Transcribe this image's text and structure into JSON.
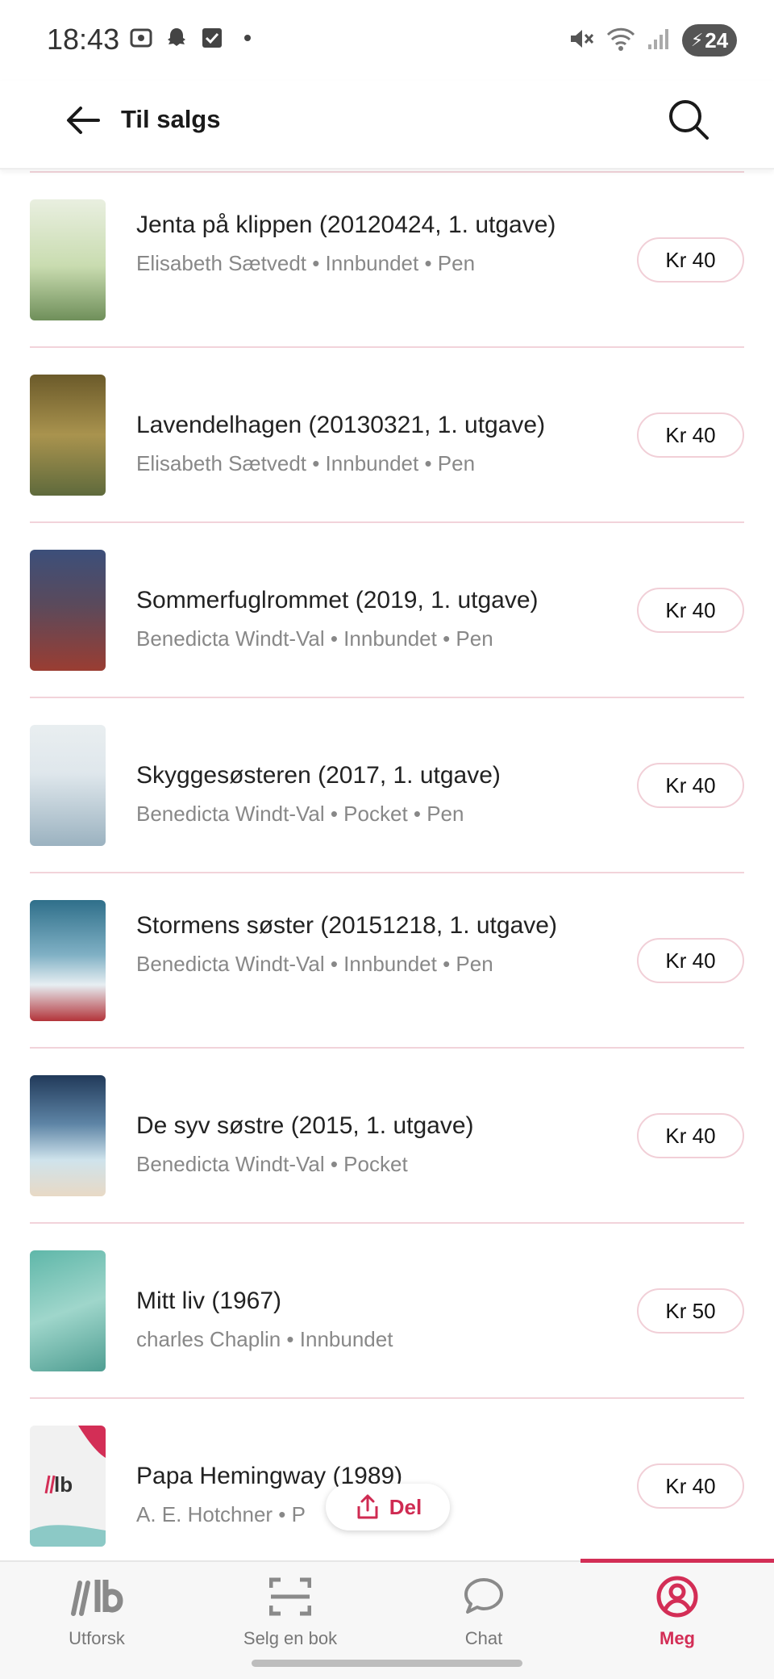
{
  "status_bar": {
    "time": "18:43",
    "battery": "24"
  },
  "app_bar": {
    "title": "Til salgs"
  },
  "books": [
    {
      "title": "Jenta på klippen (20120424, 1. utgave)",
      "meta": "Elisabeth Sætvedt • Innbundet • Pen",
      "price": "Kr 40",
      "cover_colors": [
        "#c9dcb0",
        "#6f8f5a"
      ]
    },
    {
      "title": "Lavendelhagen (20130321, 1. utgave)",
      "meta": "Elisabeth Sætvedt • Innbundet • Pen",
      "price": "Kr 40",
      "cover_colors": [
        "#6b5a2a",
        "#a9934e"
      ]
    },
    {
      "title": "Sommerfuglrommet (2019, 1. utgave)",
      "meta": "Benedicta Windt-Val • Innbundet • Pen",
      "price": "Kr 40",
      "cover_colors": [
        "#3c4f7a",
        "#9a3d32"
      ]
    },
    {
      "title": "Skyggesøsteren (2017, 1. utgave)",
      "meta": "Benedicta Windt-Val • Pocket • Pen",
      "price": "Kr 40",
      "cover_colors": [
        "#dfe7ec",
        "#9bb2c0"
      ]
    },
    {
      "title": "Stormens søster (20151218, 1. utgave)",
      "meta": "Benedicta Windt-Val • Innbundet • Pen",
      "price": "Kr 40",
      "cover_colors": [
        "#2f6f8a",
        "#e7eef2"
      ]
    },
    {
      "title": "De syv søstre (2015, 1. utgave)",
      "meta": "Benedicta Windt-Val • Pocket",
      "price": "Kr 40",
      "cover_colors": [
        "#213a5a",
        "#cfe3ec"
      ]
    },
    {
      "title": "Mitt liv (1967)",
      "meta": "charles Chaplin • Innbundet",
      "price": "Kr 50",
      "cover_colors": [
        "#5fb7a9",
        "#9fd6cb"
      ]
    },
    {
      "title": "Papa Hemingway (1989)",
      "meta": "A. E. Hotchner • P",
      "price": "Kr 40",
      "cover_colors": [
        "#f3f3f3",
        "#e8e8e8"
      ]
    }
  ],
  "share_button": {
    "label": "Del"
  },
  "bottom_nav": [
    {
      "label": "Utforsk",
      "icon": "lb-logo-icon",
      "active": false
    },
    {
      "label": "Selg en bok",
      "icon": "scan-icon",
      "active": false
    },
    {
      "label": "Chat",
      "icon": "chat-bubble-icon",
      "active": false
    },
    {
      "label": "Meg",
      "icon": "user-icon",
      "active": true
    }
  ],
  "colors": {
    "accent": "#d32e56",
    "divider": "#f2d3da",
    "muted_text": "#888888"
  }
}
